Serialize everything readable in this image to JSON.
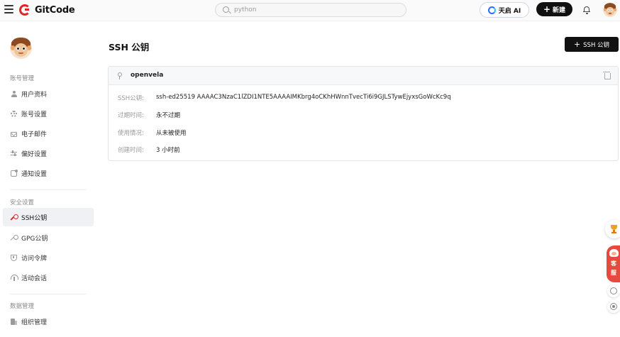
{
  "header": {
    "brand": "GitCode",
    "search_placeholder": "python",
    "ai_button_label": "天启 AI",
    "new_button_label": "新建"
  },
  "sidebar": {
    "account_section": "账号管理",
    "account_items": [
      {
        "label": "用户资料",
        "icon": "user-icon"
      },
      {
        "label": "账号设置",
        "icon": "gear-icon"
      },
      {
        "label": "电子邮件",
        "icon": "mail-icon"
      },
      {
        "label": "偏好设置",
        "icon": "sliders-icon"
      },
      {
        "label": "通知设置",
        "icon": "notification-icon"
      }
    ],
    "security_section": "安全设置",
    "security_items": [
      {
        "label": "SSH公钥",
        "icon": "key-icon",
        "active": true
      },
      {
        "label": "GPG公钥",
        "icon": "key-icon"
      },
      {
        "label": "访问令牌",
        "icon": "shield-icon"
      },
      {
        "label": "活动会话",
        "icon": "signal-icon"
      }
    ],
    "data_section": "数据管理",
    "data_items": [
      {
        "label": "组织管理",
        "icon": "organization-icon"
      }
    ]
  },
  "main": {
    "title": "SSH 公钥",
    "add_button_label": "SSH 公钥",
    "key_card": {
      "name": "openvela",
      "rows": [
        {
          "label": "SSH公钥:",
          "value": "ssh-ed25519 AAAAC3NzaC1lZDI1NTE5AAAAIMKbrg4oCKhHWnnTvecTi6i9GJLSTywEjyxsGoWcKc9q"
        },
        {
          "label": "过期时间:",
          "value": "永不过期"
        },
        {
          "label": "使用情况:",
          "value": "从未被使用"
        },
        {
          "label": "创建时间:",
          "value": "3 小时前"
        }
      ]
    }
  },
  "floating": {
    "service_label_1": "客",
    "service_label_2": "服"
  },
  "colors": {
    "brand_red": "#e3242b",
    "dark_button": "#111111",
    "active_bg": "#f0f1f5"
  }
}
